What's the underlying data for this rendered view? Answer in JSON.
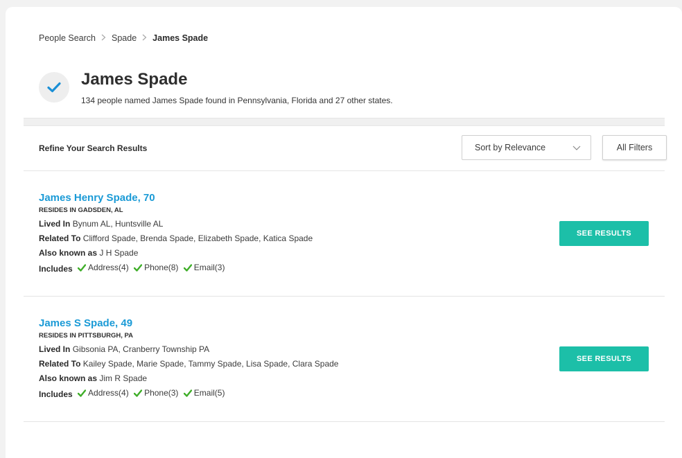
{
  "breadcrumb": {
    "items": [
      "People Search",
      "Spade",
      "James Spade"
    ]
  },
  "header": {
    "title": "James Spade",
    "subtitle": "134 people named James Spade found in Pennsylvania, Florida and 27 other states."
  },
  "refine": {
    "label": "Refine Your Search Results",
    "sort_label": "Sort by Relevance",
    "filters_label": "All Filters"
  },
  "labels": {
    "lived_in": "Lived In",
    "related_to": "Related To",
    "also_known_as": "Also known as",
    "includes": "Includes",
    "see_results": "SEE RESULTS"
  },
  "results": [
    {
      "name": "James Henry Spade, 70",
      "resides": "RESIDES IN GADSDEN, AL",
      "lived_in": "Bynum AL, Huntsville AL",
      "related_to": "Clifford Spade, Brenda Spade, Elizabeth Spade, Katica Spade",
      "also_known_as": "J H Spade",
      "includes": [
        "Address(4)",
        "Phone(8)",
        "Email(3)"
      ]
    },
    {
      "name": "James S Spade, 49",
      "resides": "RESIDES IN PITTSBURGH, PA",
      "lived_in": "Gibsonia PA, Cranberry Township PA",
      "related_to": "Kailey Spade, Marie Spade, Tammy Spade, Lisa Spade, Clara Spade",
      "also_known_as": "Jim R Spade",
      "includes": [
        "Address(4)",
        "Phone(3)",
        "Email(5)"
      ]
    }
  ],
  "colors": {
    "link": "#1a9ad6",
    "button": "#1cbfa8",
    "check": "#3fae29",
    "title_check": "#1a8fd6"
  }
}
